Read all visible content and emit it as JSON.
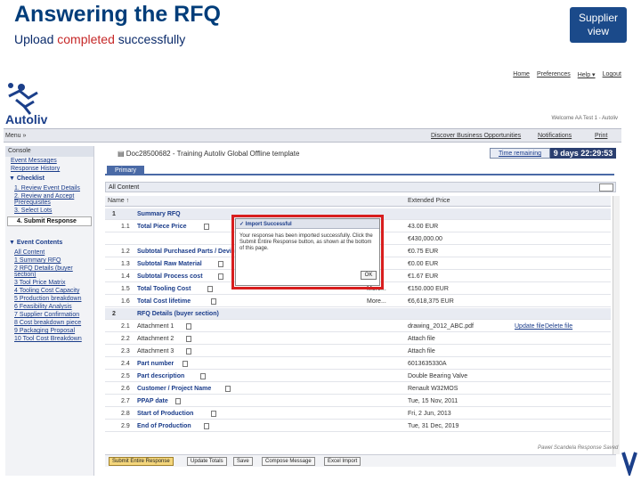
{
  "slide": {
    "title": "Answering the RFQ",
    "subtitle_pre": "Upload ",
    "subtitle_hl": "completed",
    "subtitle_post": " successfully",
    "badge_line1": "Supplier",
    "badge_line2": "view"
  },
  "colors": {
    "title": "#003d7a",
    "badge": "#1b4a8a",
    "highlight": "#d81e1e",
    "accent": "#4a6aa6",
    "time": "#2b3f70"
  },
  "app": {
    "brand": "Autoliv",
    "top_links": [
      "Home",
      "Preferences",
      "Help ▾",
      "Logout"
    ],
    "welcome": "Welcome AA Test 1 - Autoliv",
    "menu": "Menu »",
    "nav_right": [
      "Discover Business Opportunities",
      "Notifications",
      "Print"
    ],
    "icons": [
      "autoliv-logo-icon",
      "document-icon",
      "print-icon",
      "check-icon",
      "triangle-down-icon",
      "pdf-icon"
    ]
  },
  "left": {
    "header": "Console",
    "links": [
      "Event Messages",
      "Response History"
    ],
    "checklist_title": "Checklist",
    "steps": [
      "1. Review Event Details",
      "2. Review and Accept Prerequisites",
      "3. Select Lots",
      "4. Submit Response"
    ],
    "event_title": "Event Contents",
    "event_items": [
      "All Content",
      "1 Summary RFQ",
      "2 RFQ Details (buyer section)",
      "3 Tool Price Matrix",
      "4 Tooling Cost Capacity",
      "5 Production breakdown",
      "6 Feasibility Analysis",
      "7 Supplier Confirmation",
      "8 Cost breakdown piece",
      "9 Packaging Proposal",
      "10 Tool Cost Breakdown"
    ]
  },
  "main": {
    "doc_title": "Doc28500682 - Training Autoliv Global Offline template",
    "time_label": "Time remaining",
    "time_value": "9 days 22:29:53",
    "tab": "Primary",
    "all_content": "All Content",
    "col_name": "Name ↑",
    "col_price": "Extended Price",
    "rows": [
      {
        "type": "sec",
        "num": "1",
        "label": "Summary RFQ",
        "more": "",
        "val": "",
        "act": "",
        "act2": ""
      },
      {
        "type": "item",
        "num": "1.1",
        "label": "Total Piece Price",
        "more": "",
        "val": "43.00 EUR",
        "act": "",
        "act2": ""
      },
      {
        "type": "item",
        "num": "",
        "label": "",
        "more": "",
        "val": "€430,000.00",
        "act": "",
        "act2": ""
      },
      {
        "type": "item",
        "num": "1.2",
        "label": "Subtotal Purchased Parts / Devices",
        "more": "",
        "val": "€0.75 EUR",
        "act": "",
        "act2": ""
      },
      {
        "type": "item",
        "num": "1.3",
        "label": "Subtotal Raw Material",
        "more": "",
        "val": "€0.00 EUR",
        "act": "",
        "act2": ""
      },
      {
        "type": "item",
        "num": "1.4",
        "label": "Subtotal Process cost",
        "more": "",
        "val": "€1.67 EUR",
        "act": "",
        "act2": ""
      },
      {
        "type": "item",
        "num": "1.5",
        "label": "Total Tooling Cost",
        "more": "More...",
        "val": "€150.000 EUR",
        "act": "",
        "act2": ""
      },
      {
        "type": "item",
        "num": "1.6",
        "label": "Total Cost lifetime",
        "more": "More...",
        "val": "€6,618,375 EUR",
        "act": "",
        "act2": ""
      },
      {
        "type": "sec",
        "num": "2",
        "label": "RFQ Details (buyer section)",
        "more": "",
        "val": "",
        "act": "",
        "act2": ""
      },
      {
        "type": "plain",
        "num": "2.1",
        "label": "Attachment 1",
        "more": "",
        "val": "drawing_2012_ABC.pdf",
        "act": "Update file",
        "act2": "Delete file"
      },
      {
        "type": "plain",
        "num": "2.2",
        "label": "Attachment 2",
        "more": "",
        "val": "Attach file",
        "act": "",
        "act2": ""
      },
      {
        "type": "plain",
        "num": "2.3",
        "label": "Attachment 3",
        "more": "",
        "val": "Attach file",
        "act": "",
        "act2": ""
      },
      {
        "type": "item",
        "num": "2.4",
        "label": "Part number",
        "more": "",
        "val": "6013635330A",
        "act": "",
        "act2": ""
      },
      {
        "type": "item",
        "num": "2.5",
        "label": "Part description",
        "more": "",
        "val": "Double Bearing Valve",
        "act": "",
        "act2": ""
      },
      {
        "type": "item",
        "num": "2.6",
        "label": "Customer / Project Name",
        "more": "",
        "val": "Renault W32MOS",
        "act": "",
        "act2": ""
      },
      {
        "type": "item",
        "num": "2.7",
        "label": "PPAP date",
        "more": "",
        "val": "Tue, 15 Nov, 2011",
        "act": "",
        "act2": ""
      },
      {
        "type": "item",
        "num": "2.8",
        "label": "Start of Production",
        "more": "",
        "val": "Fri, 2 Jun, 2013",
        "act": "",
        "act2": ""
      },
      {
        "type": "item",
        "num": "2.9",
        "label": "End of Production",
        "more": "",
        "val": "Tue, 31 Dec, 2019",
        "act": "",
        "act2": ""
      }
    ],
    "signature": "Pawel Scandela Response Saved",
    "buttons": [
      "Submit Entire Response",
      "Update Totals",
      "Save",
      "Compose Message",
      "Excel Import"
    ]
  },
  "popup": {
    "title": "Import Successful",
    "message": "Your response has been imported successfully. Click the Submit Entire Response button, as shown at the bottom of this page.",
    "ok": "OK"
  }
}
